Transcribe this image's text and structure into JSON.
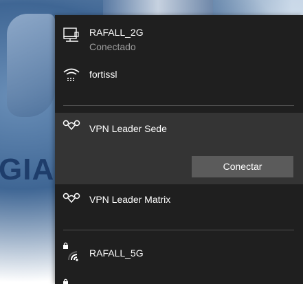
{
  "background": {
    "brand_text": "GIA"
  },
  "networks": [
    {
      "name": "RAFALL_2G",
      "status": "Conectado",
      "icon": "ethernet-icon"
    },
    {
      "name": "fortissl",
      "icon": "dialup-icon"
    }
  ],
  "vpns": [
    {
      "name": "VPN Leader Sede",
      "action_label": "Conectar",
      "icon": "vpn-icon"
    },
    {
      "name": "VPN Leader Matrix",
      "icon": "vpn-icon"
    }
  ],
  "wifi": [
    {
      "name": "RAFALL_5G",
      "icon": "wifi-secured-icon"
    }
  ],
  "colors": {
    "panel": "#1f1f1f",
    "selected": "#343434",
    "button": "#5b5b5b",
    "secondary_text": "#9d9d9d"
  }
}
